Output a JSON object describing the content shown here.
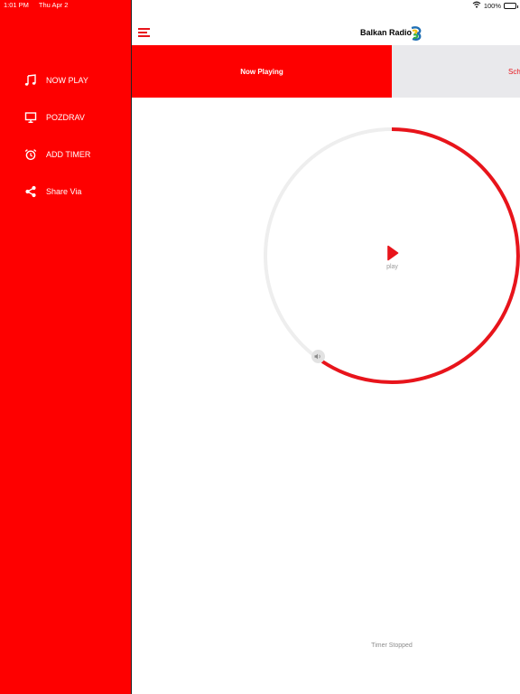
{
  "status_bar": {
    "time": "1:01 PM",
    "date": "Thu Apr 2",
    "battery": "100%"
  },
  "sidebar": {
    "items": [
      {
        "label": "NOW PLAY",
        "icon": "music-note-icon"
      },
      {
        "label": "POZDRAV",
        "icon": "monitor-icon"
      },
      {
        "label": "ADD TIMER",
        "icon": "alarm-clock-icon"
      },
      {
        "label": "Share Via",
        "icon": "share-icon"
      }
    ]
  },
  "header": {
    "title": "Balkan Radio",
    "logo": "balkan-radio-logo"
  },
  "tabs": [
    {
      "label": "Now Playing",
      "active": true
    },
    {
      "label": "Sch",
      "active": false
    }
  ],
  "player": {
    "play_label": "play",
    "icon": "play-icon"
  },
  "timer": {
    "status": "Timer Stopped"
  },
  "colors": {
    "accent": "#fe0000",
    "track": "#eeeeee",
    "tab_inactive_bg": "#e9e9ec"
  }
}
